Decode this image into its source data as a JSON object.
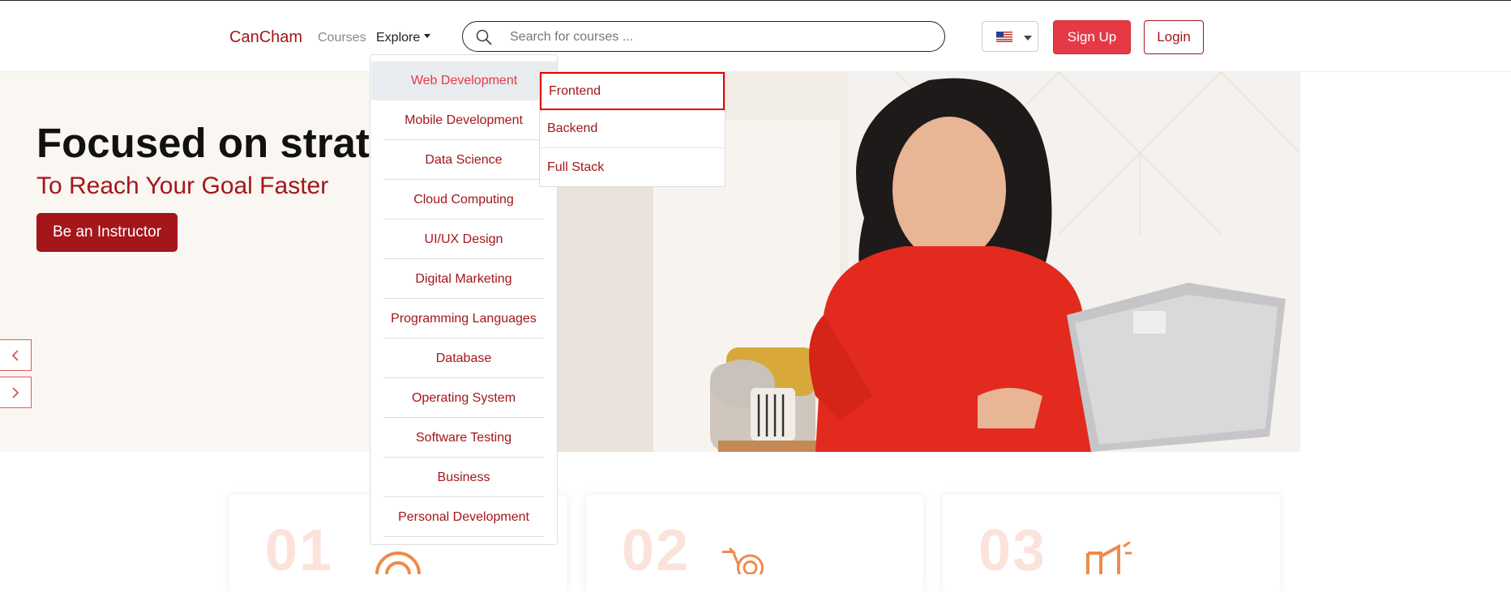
{
  "navbar": {
    "brand": "CanCham",
    "courses_link": "Courses",
    "explore_link": "Explore",
    "search_placeholder": "Search for courses ...",
    "language_flag": "us-flag-icon",
    "signup_label": "Sign Up",
    "login_label": "Login"
  },
  "hero": {
    "title": "Focused on strategy",
    "subtitle": "To Reach Your Goal Faster",
    "cta_label": "Be an Instructor",
    "prev_icon": "chevron-left-icon",
    "next_icon": "chevron-right-icon"
  },
  "explore_menu": {
    "items": [
      {
        "label": "Web Development",
        "active": true
      },
      {
        "label": "Mobile Development"
      },
      {
        "label": "Data Science"
      },
      {
        "label": "Cloud Computing"
      },
      {
        "label": "UI/UX Design"
      },
      {
        "label": "Digital Marketing"
      },
      {
        "label": "Programming Languages"
      },
      {
        "label": "Database"
      },
      {
        "label": "Operating System"
      },
      {
        "label": "Software Testing"
      },
      {
        "label": "Business"
      },
      {
        "label": "Personal Development"
      }
    ],
    "submenu": [
      {
        "label": "Frontend",
        "highlighted": true
      },
      {
        "label": "Backend"
      },
      {
        "label": "Full Stack"
      }
    ]
  },
  "feature_cards": [
    {
      "number": "01",
      "icon": "target-icon"
    },
    {
      "number": "02",
      "icon": "arrow-target-icon"
    },
    {
      "number": "03",
      "icon": "megaphone-icon"
    }
  ],
  "colors": {
    "brand": "#a4161a",
    "accent": "#e63946",
    "highlight_border": "#e60000"
  }
}
